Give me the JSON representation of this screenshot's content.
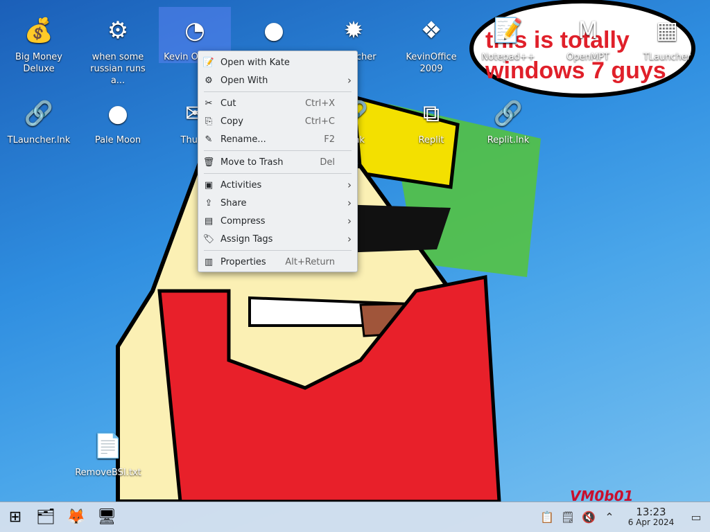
{
  "desktop": {
    "icons": [
      {
        "label": "Big Money Deluxe",
        "glyph": "💰",
        "name": "desktop-icon-big-money"
      },
      {
        "label": "when some russian runs a...",
        "glyph": "⚙",
        "name": "desktop-icon-russian"
      },
      {
        "label": "Kevin Optimiz",
        "glyph": "◔",
        "name": "desktop-icon-kevin-optimizer"
      },
      {
        "label": "",
        "glyph": "●",
        "name": "desktop-icon-red-disc"
      },
      {
        "label": "Blast cher",
        "glyph": "✹",
        "name": "desktop-icon-blast"
      },
      {
        "label": "KevinOffice 2009",
        "glyph": "❖",
        "name": "desktop-icon-kevinoffice"
      },
      {
        "label": "Notepad++",
        "glyph": "📝",
        "name": "desktop-icon-notepadpp"
      },
      {
        "label": "OpenMPT",
        "glyph": "M",
        "name": "desktop-icon-openmpt"
      },
      {
        "label": "TLauncher",
        "glyph": "▦",
        "name": "desktop-icon-tlauncher"
      },
      {
        "label": "TLauncher.lnk",
        "glyph": "🔗",
        "name": "desktop-icon-tlauncher-lnk"
      },
      {
        "label": "Pale Moon",
        "glyph": "●",
        "name": "desktop-icon-pale-moon"
      },
      {
        "label": "Thund",
        "glyph": "✉",
        "name": "desktop-icon-thunderbird"
      },
      {
        "label": "d.lnk",
        "glyph": "🔗",
        "name": "desktop-icon-d-lnk"
      },
      {
        "label": "Replit",
        "glyph": "⧉",
        "name": "desktop-icon-replit"
      },
      {
        "label": "Replit.lnk",
        "glyph": "🔗",
        "name": "desktop-icon-replit-lnk"
      },
      {
        "label": "RemoveBSI.txt",
        "glyph": "📄",
        "name": "desktop-icon-removebsi"
      }
    ],
    "banner": "this is totally windows 7 guys",
    "watermark": "VM0b01"
  },
  "menu": {
    "items": [
      {
        "label": "Open with Kate",
        "icon": "📝",
        "shortcut": "",
        "sub": ""
      },
      {
        "label": "Open With",
        "icon": "⚙",
        "shortcut": "",
        "sub": "›"
      },
      {
        "sep": true
      },
      {
        "label": "Cut",
        "icon": "✂",
        "shortcut": "Ctrl+X",
        "sub": ""
      },
      {
        "label": "Copy",
        "icon": "⎘",
        "shortcut": "Ctrl+C",
        "sub": ""
      },
      {
        "label": "Rename...",
        "icon": "✎",
        "shortcut": "F2",
        "sub": ""
      },
      {
        "sep": true
      },
      {
        "label": "Move to Trash",
        "icon": "🗑",
        "shortcut": "Del",
        "sub": ""
      },
      {
        "sep": true
      },
      {
        "label": "Activities",
        "icon": "▣",
        "shortcut": "",
        "sub": "›"
      },
      {
        "label": "Share",
        "icon": "⇪",
        "shortcut": "",
        "sub": "›"
      },
      {
        "label": "Compress",
        "icon": "▤",
        "shortcut": "",
        "sub": "›"
      },
      {
        "label": "Assign Tags",
        "icon": "🏷",
        "shortcut": "",
        "sub": "›"
      },
      {
        "sep": true
      },
      {
        "label": "Properties",
        "icon": "▥",
        "shortcut": "Alt+Return",
        "sub": ""
      }
    ]
  },
  "taskbar": {
    "start": "⊞",
    "apps": [
      "🗂",
      "🦊",
      "🖥"
    ],
    "tray": [
      "📋",
      "🗒",
      "🔇",
      "⌃"
    ],
    "time": "13:23",
    "date": "6 Apr 2024",
    "show_desktop": "▭"
  }
}
